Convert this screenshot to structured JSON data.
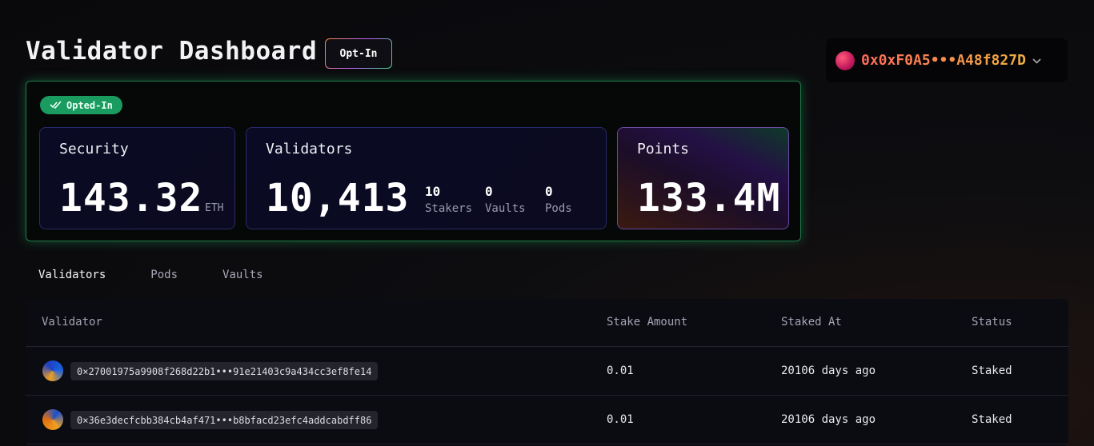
{
  "header": {
    "title": "Validator Dashboard",
    "opt_in_label": "Opt-In",
    "wallet_address": "0x0xF0A5•••A48f827D"
  },
  "stats": {
    "badge": "Opted-In",
    "security": {
      "label": "Security",
      "value": "143.32",
      "unit": "ETH"
    },
    "validators": {
      "label": "Validators",
      "value": "10,413",
      "stakers_value": "10",
      "stakers_label": "Stakers",
      "vaults_value": "0",
      "vaults_label": "Vaults",
      "pods_value": "0",
      "pods_label": "Pods"
    },
    "points": {
      "label": "Points",
      "value": "133.4M"
    }
  },
  "tabs": [
    {
      "label": "Validators",
      "active": true
    },
    {
      "label": "Pods",
      "active": false
    },
    {
      "label": "Vaults",
      "active": false
    }
  ],
  "table": {
    "columns": [
      "Validator",
      "Stake Amount",
      "Staked At",
      "Status"
    ],
    "rows": [
      {
        "validator": "0×27001975a9908f268d22b1•••91e21403c9a434cc3ef8fe14",
        "stake": "0.01",
        "staked_at": "20106 days ago",
        "status": "Staked"
      },
      {
        "validator": "0×36e3decfcbb384cb4af471•••b8bfacd23efc4addcabdff86",
        "stake": "0.01",
        "staked_at": "20106 days ago",
        "status": "Staked"
      }
    ]
  },
  "colors": {
    "accent_green": "#1a9b60",
    "wallet_gradient_start": "#ff6a5a",
    "wallet_gradient_end": "#f0b040"
  }
}
